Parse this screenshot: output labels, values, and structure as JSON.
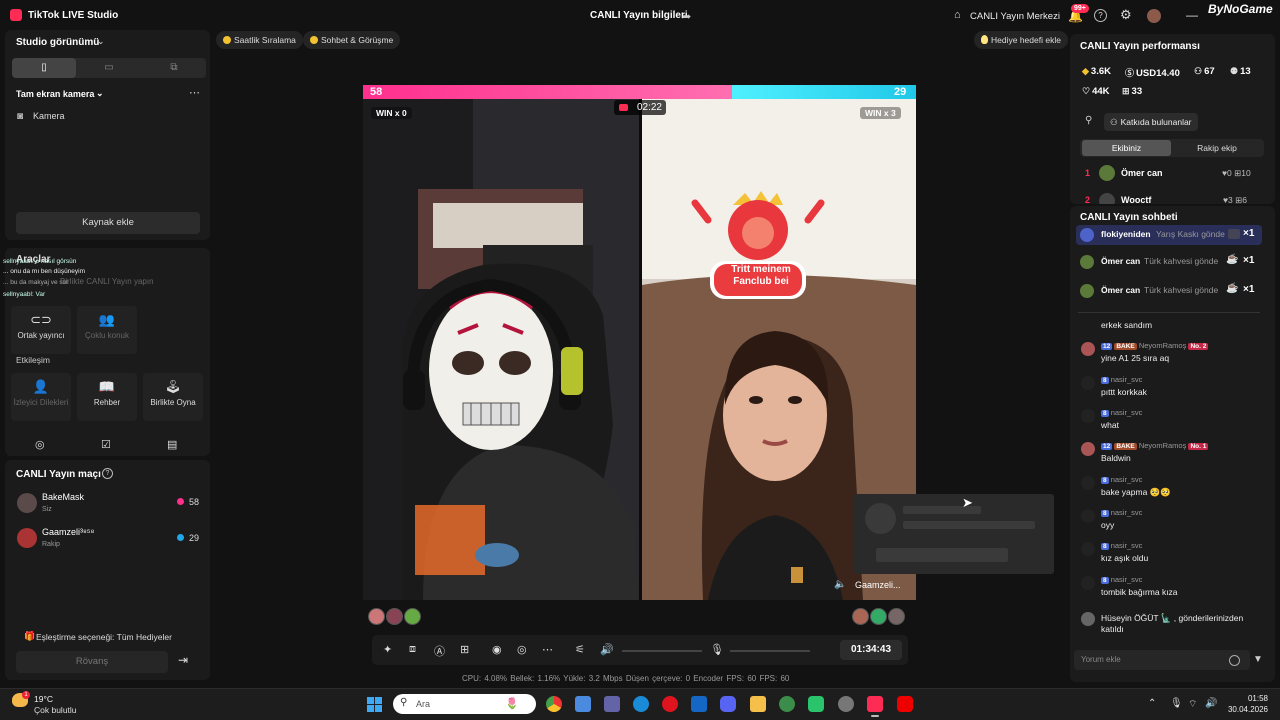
{
  "titlebar": {
    "app_title": "TikTok LIVE Studio",
    "center_title": "CANLI Yayın bilgileri",
    "hub_label": "CANLI Yayın Merkezi",
    "notif_badge": "99+",
    "watermark": "ByNoGame"
  },
  "left": {
    "studio_view": "Studio görünümü",
    "camera_section": "Tam ekran kamera",
    "camera_item": "Kamera",
    "add_source": "Kaynak ekle",
    "chat_overlay": [
      "sellnyaabl: o nasıl görsün",
      "... onu da mı ben düşüneyim",
      "... bu da makyaj ve sol",
      "sellnyaabl: Var"
    ],
    "tools_title": "Araçlar",
    "tools_faded": "Birlikte CANLI Yayın yapın",
    "tool_cohost": "Ortak yayıncı",
    "tool_multi": "Çoklu konuk",
    "interaction_title": "Etkileşim",
    "tool_viewer_requests": "İzleyici Dilekleri",
    "tool_guide": "Rehber",
    "tool_play_together": "Birlikte Oyna",
    "match_title": "CANLI Yayın maçı",
    "player1": {
      "name": "BakeMask",
      "role": "Siz",
      "score": "58"
    },
    "player2": {
      "name": "Gaamzeli³⁸⁵⁸",
      "role": "Rakip",
      "score": "29"
    },
    "pair_pref": "Eşleştirme seçeneği: Tüm Hediyeler",
    "rematch": "Rövanş"
  },
  "center": {
    "pill_hourly": "Saatlik Sıralama",
    "pill_chat": "Sohbet & Görüşme",
    "gift_goal": "Hediye hedefi ekle",
    "score_left": "58",
    "score_right": "29",
    "streak_left": "WIN x 0",
    "streak_right": "WIN x 3",
    "timer": "02:22",
    "sticker_text": "Tritt meinem Fanclub bei",
    "opponent_label": "Gaamzeli...",
    "live_time": "01:34:43",
    "stats": "CPU: 4.08%     Bellek: 1.16%     Yükle: 3.2 Mbps     Düşen çerçeve: 0     Encoder FPS: 60     FPS: 60"
  },
  "right": {
    "perf_title": "CANLI Yayın performansı",
    "stats": [
      {
        "icon": "coin-icon",
        "value": "3.6K"
      },
      {
        "icon": "dollar-icon",
        "value": "USD14.40"
      },
      {
        "icon": "viewers-icon",
        "value": "67"
      },
      {
        "icon": "new-follower-icon",
        "value": "13"
      },
      {
        "icon": "heart-icon",
        "value": "44K"
      },
      {
        "icon": "gift-icon",
        "value": "33"
      }
    ],
    "contributors": "Katkıda bulunanlar",
    "team_ours": "Ekibiniz",
    "team_rival": "Rakip ekip",
    "rank1": {
      "n": "1",
      "name": "Ömer can",
      "likes": "0",
      "score": "10"
    },
    "rank2": {
      "n": "2",
      "name": "Wooctf",
      "likes": "3",
      "score": "6"
    },
    "chat_title": "CANLI Yayın sohbeti",
    "gifts": [
      {
        "name": "flokiyeniden",
        "text": "Yarış Kaskı gönde",
        "count": "×1"
      },
      {
        "name": "Ömer can",
        "text": "Türk kahvesi gönde",
        "count": "×1"
      },
      {
        "name": "Ömer can",
        "text": "Türk kahvesi gönde",
        "count": "×1"
      }
    ],
    "comments": [
      {
        "head": "",
        "msg": "erkek sandım"
      },
      {
        "head": "NeyomRamoş",
        "lv": "12",
        "fan": "BAKE",
        "no": "No. 2",
        "msg": "yine A1 25 sıra aq"
      },
      {
        "head": "nasir_svc",
        "lv": "8",
        "msg": "pıttt korkkak"
      },
      {
        "head": "nasir_svc",
        "lv": "8",
        "msg": "what"
      },
      {
        "head": "NeyomRamoş",
        "lv": "12",
        "fan": "BAKE",
        "no": "No. 1",
        "msg": "Baldwin"
      },
      {
        "head": "nasir_svc",
        "lv": "8",
        "msg": "bake yapma 🥺🥺"
      },
      {
        "head": "nasir_svc",
        "lv": "8",
        "msg": "oyy"
      },
      {
        "head": "nasir_svc",
        "lv": "8",
        "msg": "kız aşık oldu"
      },
      {
        "head": "nasir_svc",
        "lv": "8",
        "msg": "tombik bağırma kıza"
      }
    ],
    "join_msg": "Hüseyin ÖĞÜT 🗽 , gönderilerinizden katıldı",
    "comment_placeholder": "Yorum ekle"
  },
  "taskbar": {
    "temp": "19°C",
    "condition": "Çok bulutlu",
    "search": "Ara",
    "time": "01:58",
    "date": "30.04.2026"
  },
  "colors": {
    "accent": "#fe2c55",
    "score_left": "#ff2f8e",
    "score_right": "#20c8e8"
  },
  "match_progress_left": 0.667
}
